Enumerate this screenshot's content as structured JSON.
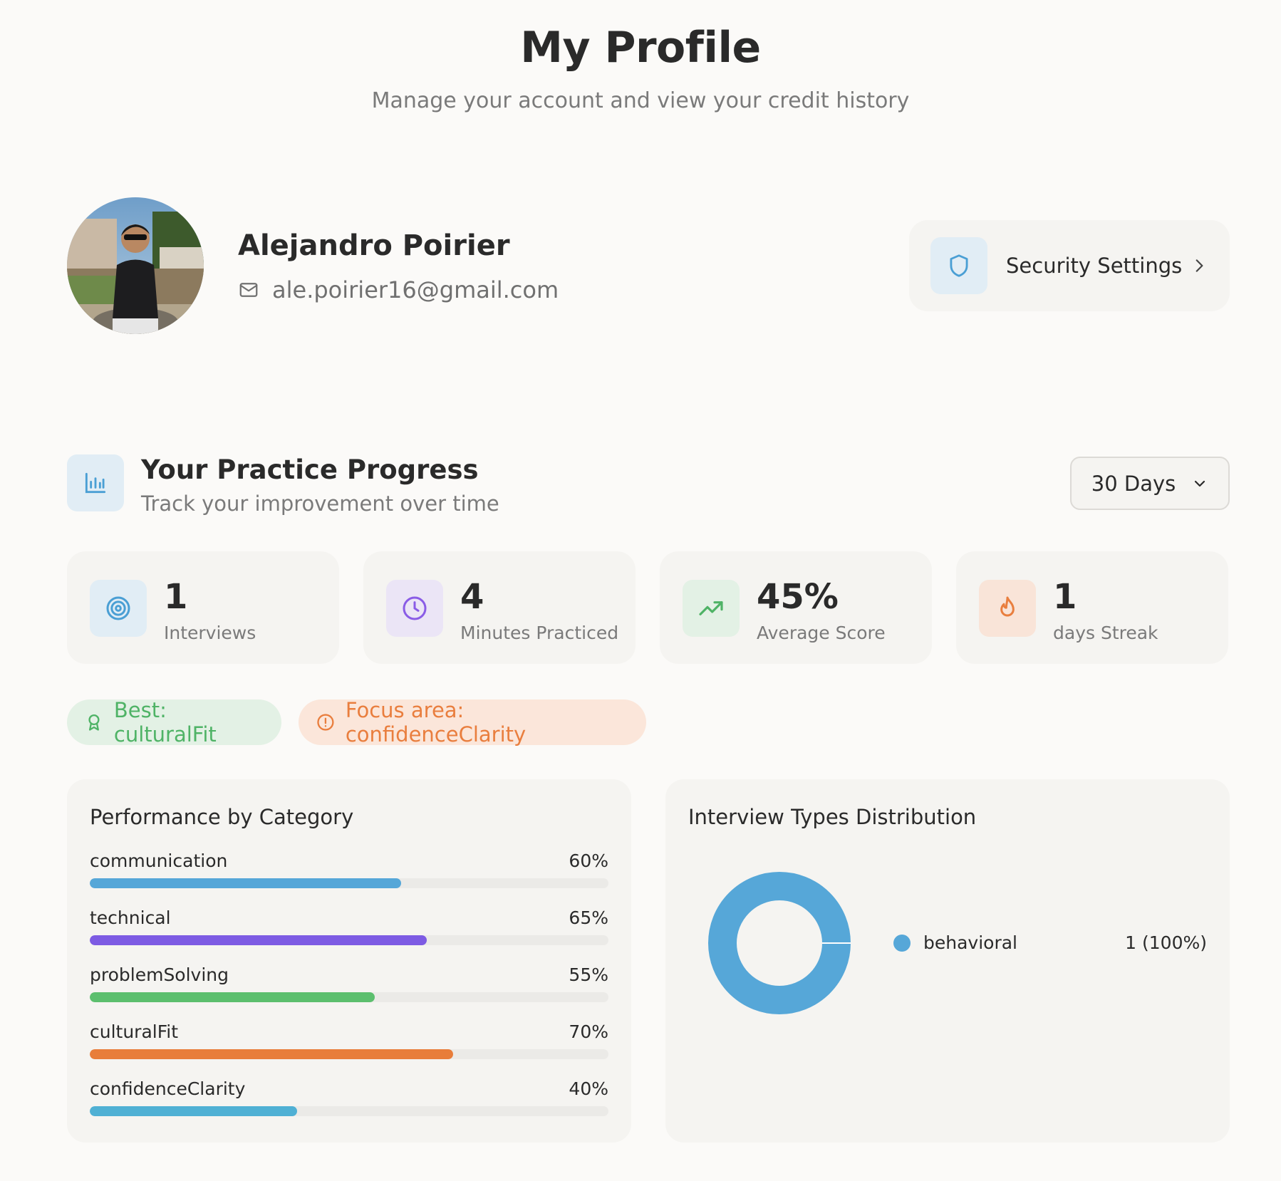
{
  "header": {
    "title": "My Profile",
    "subtitle": "Manage your account and view your credit history"
  },
  "profile": {
    "name": "Alejandro Poirier",
    "email": "ale.poirier16@gmail.com",
    "avatar_icon": "user-photo"
  },
  "security": {
    "label": "Security Settings",
    "icon": "shield-icon",
    "accent": "#4a9fd4"
  },
  "progress": {
    "title": "Your Practice Progress",
    "subtitle": "Track your improvement over time",
    "range_label": "30 Days"
  },
  "stats": [
    {
      "value": "1",
      "label": "Interviews",
      "icon": "target-icon",
      "color": "#4a9fd4",
      "tile": "#e1edf5"
    },
    {
      "value": "4",
      "label": "Minutes Practiced",
      "icon": "clock-icon",
      "color": "#8a5ce6",
      "tile": "#ebe5f6"
    },
    {
      "value": "45%",
      "label": "Average Score",
      "icon": "trending-up-icon",
      "color": "#4fb366",
      "tile": "#e3f1e5"
    },
    {
      "value": "1",
      "label": "days Streak",
      "icon": "flame-icon",
      "color": "#e97e3e",
      "tile": "#f9e4d8"
    }
  ],
  "pills": {
    "best": "Best: culturalFit",
    "focus": "Focus area: confidenceClarity"
  },
  "performance": {
    "title": "Performance by Category",
    "categories": [
      {
        "name": "communication",
        "label": "60%",
        "value": 60,
        "color": "#56a7d8"
      },
      {
        "name": "technical",
        "label": "65%",
        "value": 65,
        "color": "#7d5be3"
      },
      {
        "name": "problemSolving",
        "label": "55%",
        "value": 55,
        "color": "#5cbf6e"
      },
      {
        "name": "culturalFit",
        "label": "70%",
        "value": 70,
        "color": "#e87d3a"
      },
      {
        "name": "confidenceClarity",
        "label": "40%",
        "value": 40,
        "color": "#4fb0d4"
      }
    ]
  },
  "distribution": {
    "title": "Interview Types Distribution",
    "items": [
      {
        "name": "behavioral",
        "value_label": "1 (100%)",
        "value": 1,
        "color": "#56a7d8"
      }
    ]
  }
}
